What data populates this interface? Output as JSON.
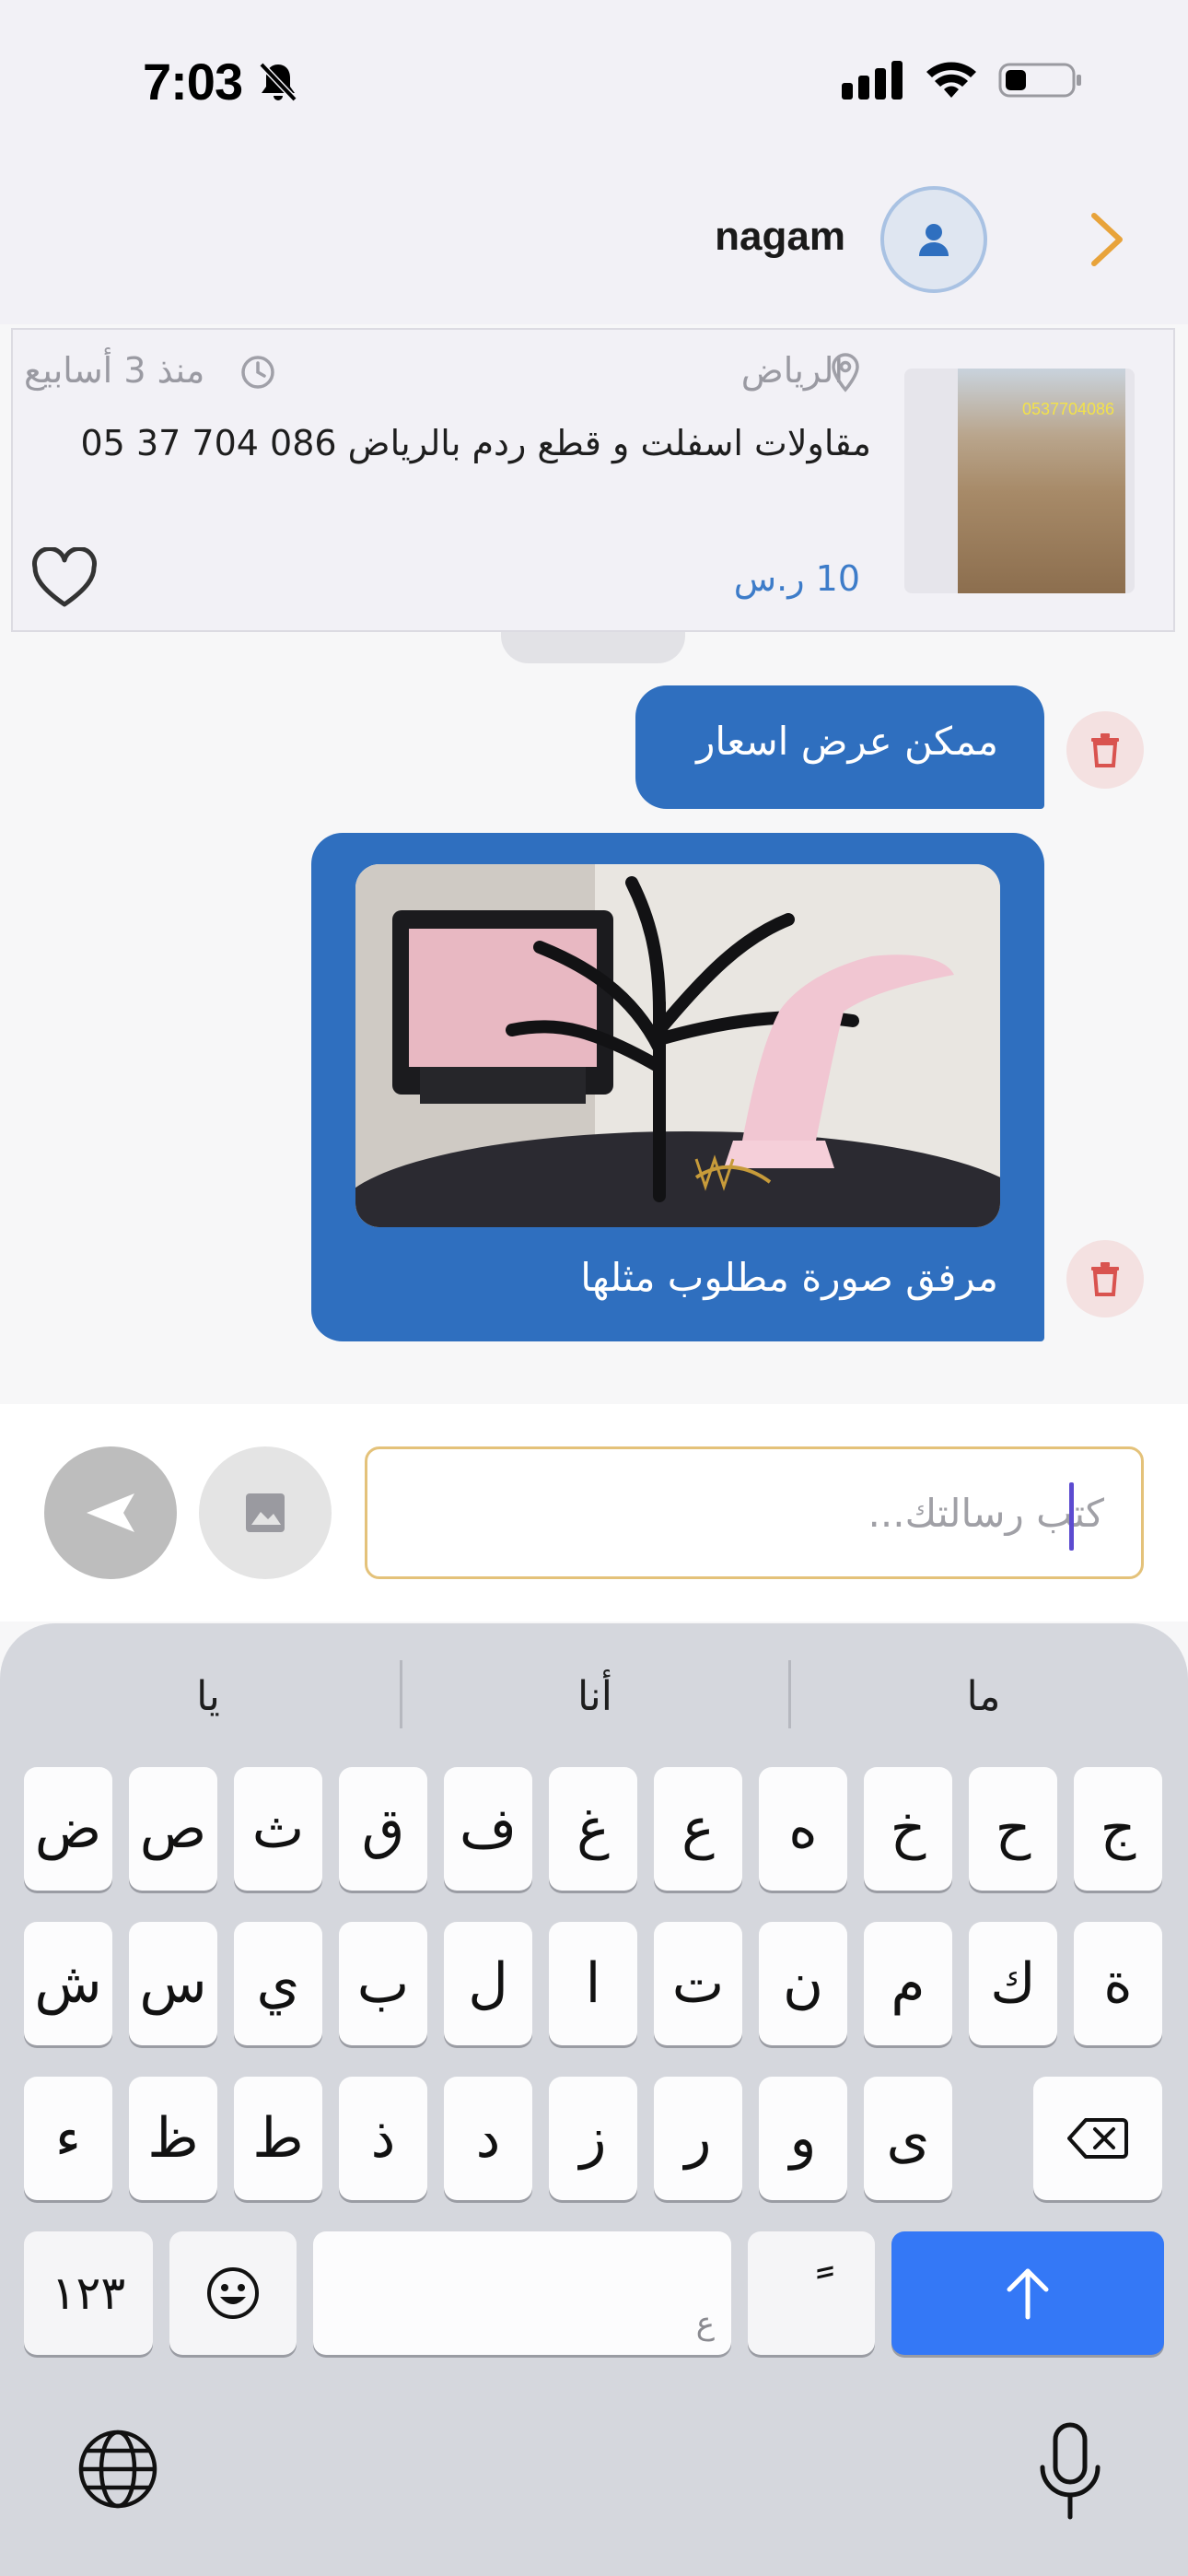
{
  "status": {
    "time": "7:03",
    "icons": [
      "bell-slash-icon",
      "cellular-signal-icon",
      "wifi-icon",
      "battery-icon"
    ]
  },
  "header": {
    "name": "nagam",
    "avatar_icon": "person-icon",
    "back_icon": "chevron-right-icon"
  },
  "listing": {
    "location": "الرياض",
    "time_ago": "منذ 3 أسابيع",
    "title": "مقاولات اسفلت و قطع ردم بالرياض 086 704 37 05",
    "price": "10 ر.س",
    "thumb_label": "0537704086"
  },
  "messages": [
    {
      "text": "ممكن عرض اسعار"
    },
    {
      "image_alt": "jewelry-tree-with-hand-stand",
      "text": "مرفق صورة مطلوب مثلها"
    }
  ],
  "composer": {
    "placeholder": "كتب رسالتك..."
  },
  "keyboard": {
    "suggestions": [
      "يا",
      "أنا",
      "ما"
    ],
    "row1": [
      "ض",
      "ص",
      "ث",
      "ق",
      "ف",
      "غ",
      "ع",
      "ه",
      "خ",
      "ح",
      "ج"
    ],
    "row2": [
      "ش",
      "س",
      "ي",
      "ب",
      "ل",
      "ا",
      "ت",
      "ن",
      "م",
      "ك",
      "ة"
    ],
    "row3": [
      "ء",
      "ظ",
      "ط",
      "ذ",
      "د",
      "ز",
      "ر",
      "و",
      "ى"
    ],
    "numbers_key": "١٢٣",
    "space_hint": "ع",
    "diacritic_key": "ً"
  },
  "colors": {
    "accent": "#2f6fbf",
    "input_border": "#e4c27a",
    "back_chevron": "#e8a33a",
    "return_key": "#3478f6"
  }
}
